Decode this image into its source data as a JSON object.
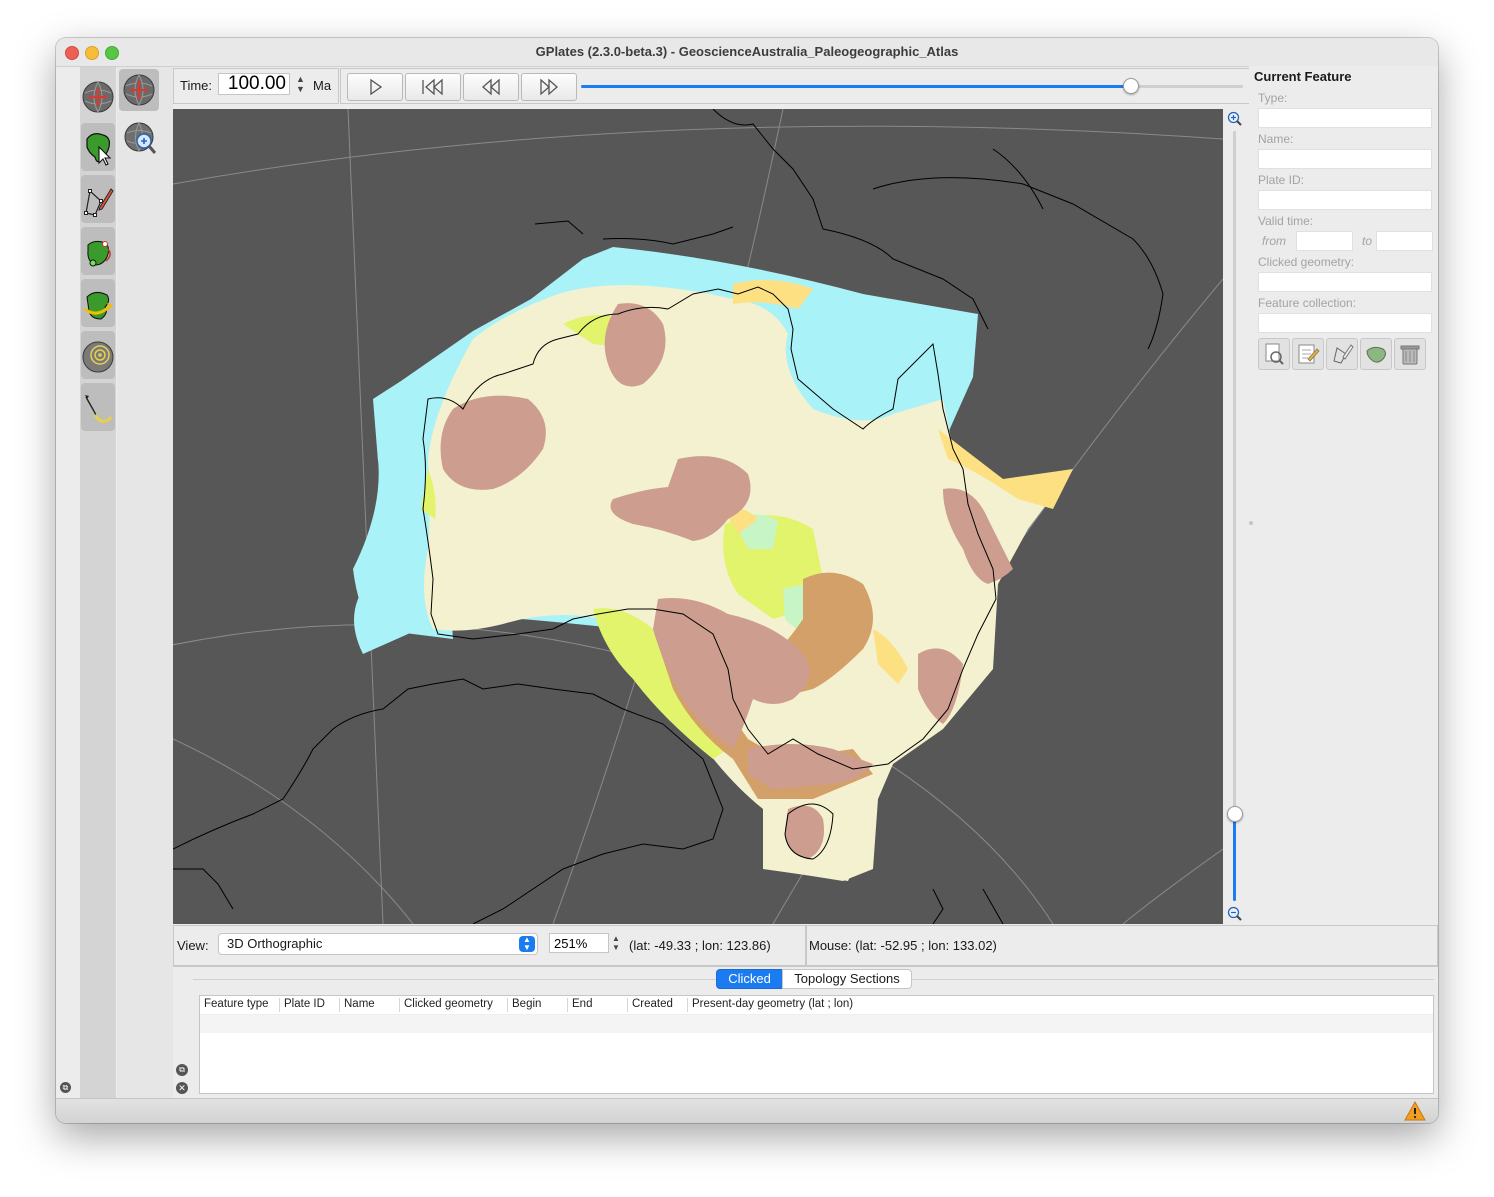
{
  "window": {
    "title": "GPlates (2.3.0-beta.3) - GeoscienceAustralia_Paleogeographic_Atlas"
  },
  "time": {
    "label": "Time:",
    "value": "100.00",
    "unit": "Ma"
  },
  "animation": {
    "slider_level": 0.83
  },
  "view": {
    "label": "View:",
    "projection": "3D Orthographic",
    "zoom": "251%",
    "camera": "(lat: -49.33 ; lon: 123.86)",
    "mouse": "Mouse: (lat: -52.95 ; lon: 133.02)"
  },
  "current_feature": {
    "title": "Current Feature",
    "type_label": "Type:",
    "name_label": "Name:",
    "plate_id_label": "Plate ID:",
    "valid_time_label": "Valid time:",
    "from_label": "from",
    "to_label": "to",
    "clicked_geometry_label": "Clicked geometry:",
    "feature_collection_label": "Feature collection:"
  },
  "tabs": {
    "clicked": "Clicked",
    "topology": "Topology Sections"
  },
  "table": {
    "columns": [
      "Feature type",
      "Plate ID",
      "Name",
      "Clicked geometry",
      "Begin",
      "End",
      "Created",
      "Present-day geometry (lat ; lon)"
    ]
  },
  "colors": {
    "accent": "#1b7cf2",
    "globe_bg": "#575757",
    "land": "#f3f1cf",
    "shallow_sea": "#a9f2f8",
    "upland": "#cd9d8f"
  },
  "icons": [
    "rotate-globe-icon",
    "zoom-globe-icon",
    "choose-feature-icon",
    "digitise-geometry-icon",
    "move-vertex-icon",
    "reconstruction-pole-icon",
    "topology-icon",
    "measure-distance-icon",
    "query-feature-icon",
    "edit-feature-icon",
    "clone-geometry-icon",
    "topology-edit-icon",
    "delete-feature-icon",
    "warning-icon"
  ]
}
